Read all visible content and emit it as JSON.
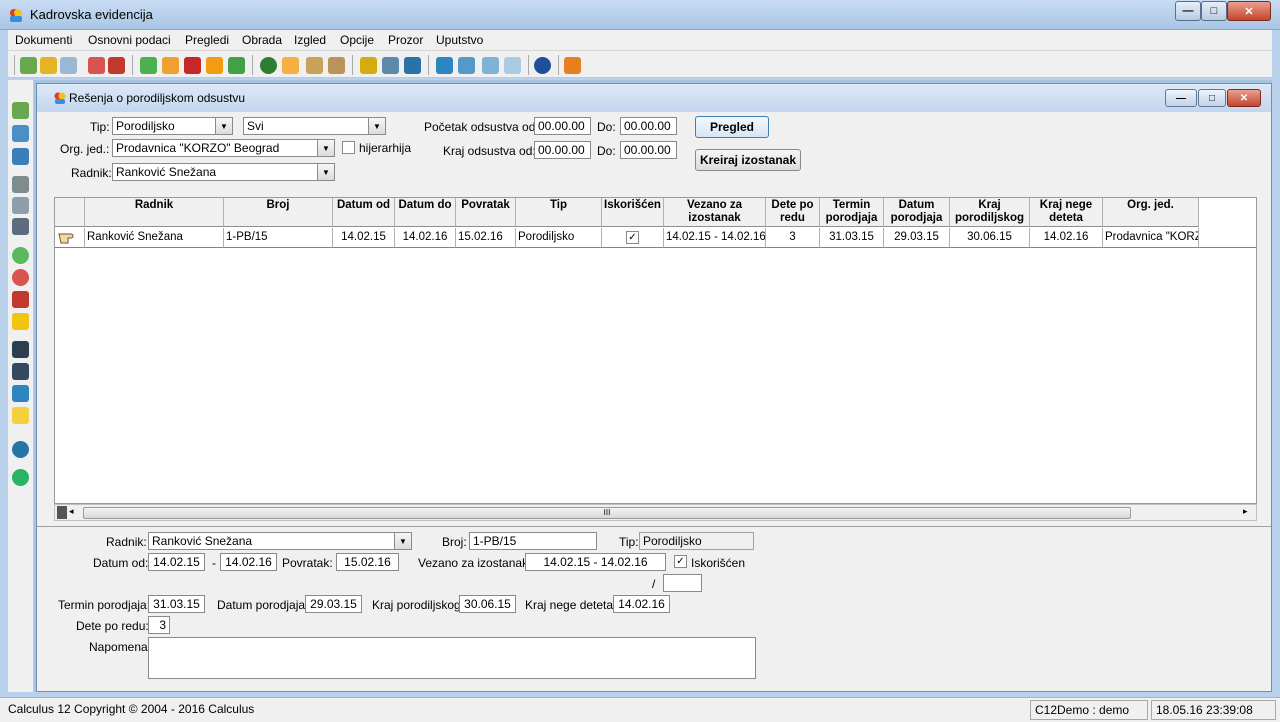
{
  "window": {
    "title": "Kadrovska evidencija",
    "min": "—",
    "max": "□",
    "close": "✕"
  },
  "menu": [
    "Dokumenti",
    "Osnovni podaci",
    "Pregledi",
    "Obrada",
    "Izgled",
    "Opcije",
    "Prozor",
    "Uputstvo"
  ],
  "child": {
    "title": "Rešenja o porodiljskom odsustvu"
  },
  "filter": {
    "tip_label": "Tip:",
    "tip_value": "Porodiljsko",
    "svi_value": "Svi",
    "org_label": "Org. jed.:",
    "org_value": "Prodavnica \"KORZO\" Beograd",
    "hijerarhija_label": "hijerarhija",
    "radnik_label": "Radnik:",
    "radnik_value": "Ranković Snežana",
    "pocetak_label": "Početak odsustva od:",
    "pocetak_od": "00.00.00",
    "do_label": "Do:",
    "pocetak_do": "00.00.00",
    "kraj_label": "Kraj odsustva od:",
    "kraj_od": "00.00.00",
    "kraj_do": "00.00.00",
    "pregled_btn": "Pregled",
    "kreiraj_btn": "Kreiraj izostanak"
  },
  "grid": {
    "columns": [
      "Radnik",
      "Broj",
      "Datum od",
      "Datum do",
      "Povratak",
      "Tip",
      "Iskorišćen",
      "Vezano za izostanak",
      "Dete po redu",
      "Termin porodjaja",
      "Datum porodjaja",
      "Kraj porodiljskog",
      "Kraj nege deteta",
      "Org. jed."
    ],
    "rows": [
      [
        "Ranković Snežana",
        "1-PB/15",
        "14.02.15",
        "14.02.16",
        "15.02.16",
        "Porodiljsko",
        "✓",
        "14.02.15 - 14.02.16",
        "3",
        "31.03.15",
        "29.03.15",
        "30.06.15",
        "14.02.16",
        "Prodavnica \"KORZO"
      ]
    ],
    "scroll_grip": "III"
  },
  "detail": {
    "radnik_label": "Radnik:",
    "radnik_value": "Ranković Snežana",
    "broj_label": "Broj:",
    "broj_value": "1-PB/15",
    "tip_label": "Tip:",
    "tip_value": "Porodiljsko",
    "datum_od_label": "Datum od:",
    "datum_od": "14.02.15",
    "dash": "-",
    "datum_do": "14.02.16",
    "povratak_label": "Povratak:",
    "povratak": "15.02.16",
    "vezano_label": "Vezano za izostanak:",
    "vezano": "14.02.15 - 14.02.16",
    "iskoriscen_label": "Iskorišćen",
    "iskoriscen_check": "✓",
    "slash": "/",
    "termin_label": "Termin porodjaja:",
    "termin": "31.03.15",
    "datum_porodjaja_label": "Datum porodjaja:",
    "datum_porodjaja": "29.03.15",
    "kraj_porodiljskog_label": "Kraj porodiljskog:",
    "kraj_porodiljskog": "30.06.15",
    "kraj_nege_label": "Kraj nege deteta:",
    "kraj_nege": "14.02.16",
    "dete_label": "Dete po redu:",
    "dete": "3",
    "napomena_label": "Napomena:"
  },
  "status": {
    "copyright": "Calculus 12  Copyright © 2004 - 2016  Calculus",
    "user": "C12Demo : demo",
    "datetime": "18.05.16 23:39:08"
  },
  "colors": {
    "accent": "#3c7fb1",
    "window_bg": "#b9d1ea"
  }
}
